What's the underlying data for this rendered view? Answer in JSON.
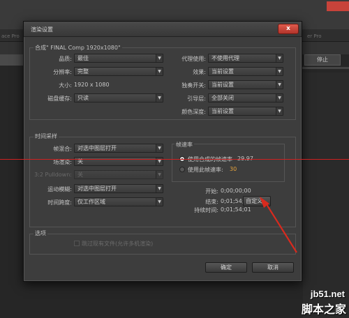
{
  "background": {
    "tab_left": "ace Pro",
    "tab_right": "er Pro",
    "stop_label": "停止"
  },
  "dialog": {
    "title": "渲染设置",
    "close_label": "x",
    "comp_group": {
      "label": "合成\" FINAL Comp 1920x1080\"",
      "quality_label": "品质:",
      "quality_value": "最佳",
      "resolution_label": "分辨率:",
      "resolution_value": "完整",
      "size_label": "大小:",
      "size_value": "1920 x 1080",
      "disk_cache_label": "磁盘缓存:",
      "disk_cache_value": "只读",
      "proxy_label": "代理使用:",
      "proxy_value": "不使用代理",
      "effects_label": "效果:",
      "effects_value": "当前设置",
      "solo_label": "独奏开关:",
      "solo_value": "当前设置",
      "guide_label": "引导层:",
      "guide_value": "全部关闭",
      "color_depth_label": "颜色深度:",
      "color_depth_value": "当前设置"
    },
    "time_group": {
      "label": "时间采样",
      "frame_blend_label": "帧混合:",
      "frame_blend_value": "对选中图层打开",
      "field_render_label": "场渲染:",
      "field_render_value": "关",
      "pulldown_label": "3:2 Pulldown:",
      "pulldown_value": "关",
      "motion_blur_label": "运动模糊:",
      "motion_blur_value": "对选中图层打开",
      "time_span_label": "时间跨度:",
      "time_span_value": "仅工作区域",
      "frame_rate_group_label": "帧速率",
      "use_comp_rate_label": "使用合成的帧速率",
      "use_comp_rate_value": "29.97",
      "use_this_rate_label": "使用此帧速率:",
      "use_this_rate_value": "30",
      "start_label": "开始:",
      "start_value": "0;00;00;00",
      "end_label": "结束:",
      "end_value": "0;01;54;00",
      "duration_label": "持续时间:",
      "duration_value": "0;01;54;01",
      "custom_button": "自定义..."
    },
    "options_group": {
      "label": "选项",
      "skip_existing_label": "跳过现有文件(允许多机渲染)"
    },
    "ok_button": "确定",
    "cancel_button": "取消"
  },
  "watermark": {
    "url": "jb51.net",
    "name": "脚本之家"
  },
  "colors": {
    "accent_orange": "#e8a43c",
    "annotation_red": "#d02020",
    "close_red": "#c8433a"
  }
}
